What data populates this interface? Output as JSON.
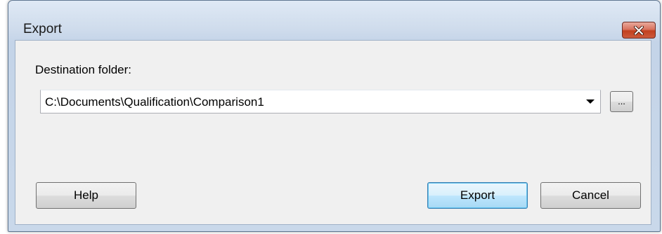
{
  "window": {
    "title": "Export"
  },
  "titlebar": {
    "close_icon": "close-icon"
  },
  "form": {
    "destination_label": "Destination folder:",
    "destination_value": "C:\\Documents\\Qualification\\Comparison1",
    "browse_label": "..."
  },
  "buttons": {
    "help": "Help",
    "export": "Export",
    "cancel": "Cancel"
  },
  "colors": {
    "close_button": "#c2401f",
    "default_button_border": "#3c7fb1"
  }
}
